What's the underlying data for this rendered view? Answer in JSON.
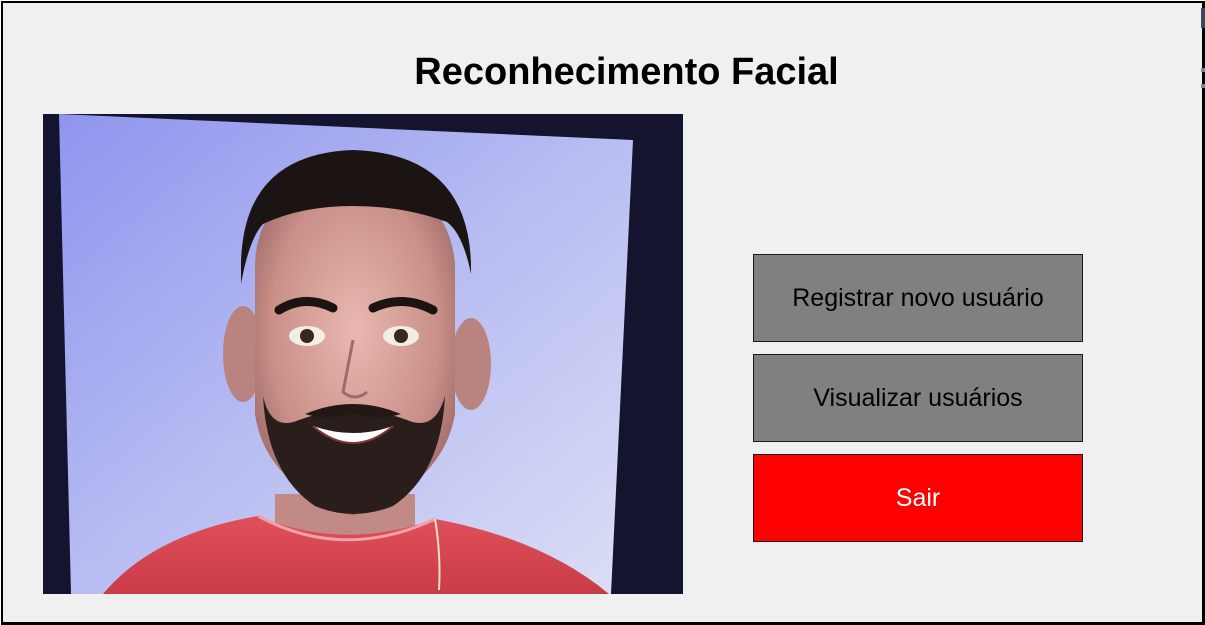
{
  "window": {
    "title": "Reconhecimento Facial"
  },
  "camera": {
    "icon": "camera-feed-image"
  },
  "buttons": {
    "register": "Registrar novo usuário",
    "view": "Visualizar usuários",
    "exit": "Sair"
  },
  "colors": {
    "background": "#f0f0f0",
    "button_gray": "#808080",
    "button_exit": "#ff0000",
    "exit_text": "#ffffff"
  }
}
